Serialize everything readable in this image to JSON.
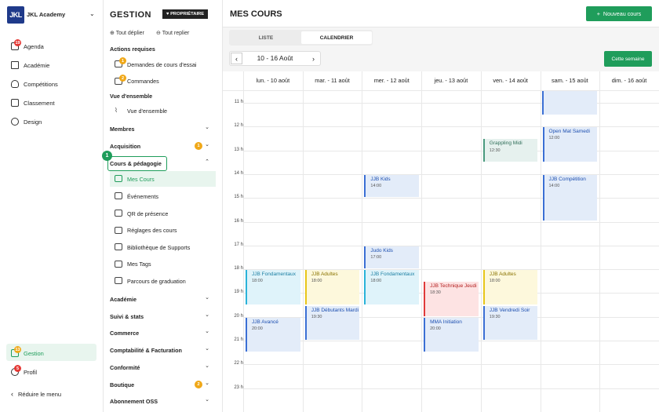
{
  "nav": {
    "logo": "JKL",
    "academy": "JKL Academy",
    "items": [
      {
        "label": "Agenda",
        "badge": "19"
      },
      {
        "label": "Académie"
      },
      {
        "label": "Compétitions"
      },
      {
        "label": "Classement"
      },
      {
        "label": "Design"
      }
    ],
    "gestion": {
      "label": "Gestion",
      "badge": "13"
    },
    "profil": {
      "label": "Profil",
      "badge": "5"
    },
    "reduce": "Réduire le menu"
  },
  "panel": {
    "title": "GESTION",
    "owner": "PROPRIÉTAIRE",
    "expand": "Tout déplier",
    "collapse": "Tout replier",
    "actions_title": "Actions requises",
    "actions": [
      {
        "label": "Demandes de cours d'essai",
        "badge": "1"
      },
      {
        "label": "Commandes",
        "badge": "2"
      }
    ],
    "overview_title": "Vue d'ensemble",
    "overview": "Vue d'ensemble",
    "membres": "Membres",
    "acquisition": "Acquisition",
    "acquisition_badge": "1",
    "cours": "Cours & pédagogie",
    "step": "1",
    "cours_items": [
      "Mes Cours",
      "Événements",
      "QR de présence",
      "Réglages des cours",
      "Bibliothèque de Supports",
      "Mes Tags",
      "Parcours de graduation"
    ],
    "sections": [
      "Académie",
      "Suivi & stats",
      "Commerce",
      "Comptabilité & Facturation",
      "Conformité",
      "Boutique",
      "Abonnement OSS"
    ],
    "boutique_badge": "2"
  },
  "main": {
    "title": "MES COURS",
    "new_button": "Nouveau cours",
    "tabs": [
      "LISTE",
      "CALENDRIER"
    ],
    "week": "10 - 16 Août",
    "this_week": "Cette semaine",
    "days": [
      "lun. - 10 août",
      "mar. - 11 août",
      "mer. - 12 août",
      "jeu. - 13 août",
      "ven. - 14 août",
      "sam. - 15 août",
      "dim. - 16 août"
    ],
    "hours": [
      "11 h",
      "12 h",
      "13 h",
      "14 h",
      "15 h",
      "16 h",
      "17 h",
      "18 h",
      "19 h",
      "20 h",
      "21 h",
      "22 h",
      "23 h"
    ],
    "events": [
      {
        "title": "Open Mat Samedi",
        "time": "12:00"
      },
      {
        "title": "Grappling Midi",
        "time": "12:30"
      },
      {
        "title": "JJB Kids",
        "time": "14:00"
      },
      {
        "title": "JJB Compétition",
        "time": "14:00"
      },
      {
        "title": "Judo Kids",
        "time": "17:00"
      },
      {
        "title": "JJB Fondamentaux",
        "time": "18:00"
      },
      {
        "title": "JJB Adultes",
        "time": "18:00"
      },
      {
        "title": "JJB Fondamentaux",
        "time": "18:00"
      },
      {
        "title": "JJB Technique Jeudi",
        "time": "18:30"
      },
      {
        "title": "JJB Adultes",
        "time": "18:00"
      },
      {
        "title": "JJB Débutants Mardi",
        "time": "19:30"
      },
      {
        "title": "JJB Vendredi Soir",
        "time": "19:30"
      },
      {
        "title": "JJB Avancé",
        "time": "20:00"
      },
      {
        "title": "MMA Initiation",
        "time": "20:00"
      }
    ]
  }
}
